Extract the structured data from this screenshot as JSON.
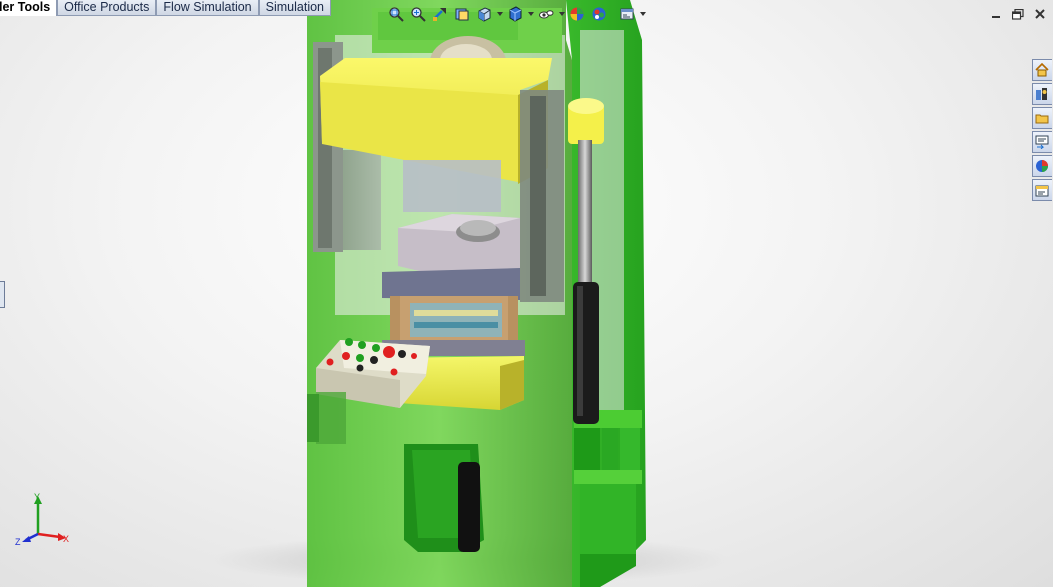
{
  "command_manager": {
    "tabs": [
      {
        "label": "ler Tools",
        "active": true
      },
      {
        "label": "Office Products",
        "active": false
      },
      {
        "label": "Flow Simulation",
        "active": false
      },
      {
        "label": "Simulation",
        "active": false
      }
    ]
  },
  "heads_up_toolbar": {
    "icons": [
      "zoom-to-fit-icon",
      "zoom-to-area-icon",
      "previous-view-icon",
      "section-view-icon",
      "view-orientation-icon",
      "display-style-icon",
      "hide-show-items-icon",
      "edit-appearance-icon",
      "apply-scene-icon",
      "view-settings-icon"
    ]
  },
  "window_controls": {
    "icons": [
      "minimize-icon",
      "restore-icon",
      "close-icon"
    ]
  },
  "task_pane": {
    "tabs": [
      "solidworks-resources-icon",
      "design-library-icon",
      "file-explorer-icon",
      "view-palette-icon",
      "appearances-scenes-icon",
      "custom-properties-icon"
    ]
  },
  "triad": {
    "x_label": "X",
    "y_label": "Y",
    "z_label": "Z",
    "x_color": "#e02020",
    "y_color": "#20a020",
    "z_color": "#2030d0"
  },
  "model": {
    "frame_color": "#6fd048",
    "ram_color": "#f3f03c",
    "column_color": "#7a8a7a"
  }
}
